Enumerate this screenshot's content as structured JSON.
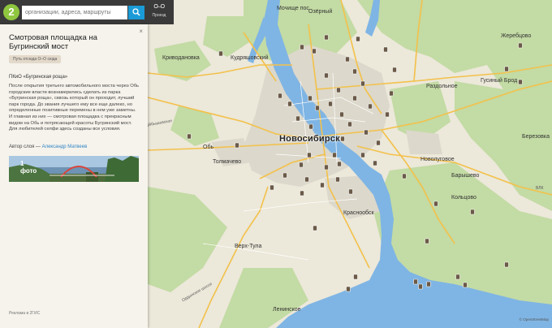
{
  "search": {
    "placeholder": "организации, адреса, маршруты",
    "logo": "2",
    "route_icon": "O–O",
    "route_label": "Проезд"
  },
  "panel": {
    "close": "×",
    "title": "Смотровая площадка на Бугринский мост",
    "route_chip": "Путь отсюда O–O сюда",
    "place_name": "ПКиО «Бугринская роща»",
    "description": "После открытия третьего автомобильного моста через Обь городские власти вознамерились сделать из парка «Бугринская роща», сквозь который он проходит, лучший парк города. До звания лучшего ему все еще далеко, но определенные позитивные перемены в нем уже заметны. И главная из них — смотровая площадка с прекрасным видом на Обь и потрясающей красоты Бугринский мост. Для любителей селфи здесь созданы все условия.",
    "author_prefix": "Автор слоя — ",
    "author_name": "Александр Матвеев",
    "photo_count": "1",
    "photo_label": "фото",
    "ad": "Реклама в 2ГИС"
  },
  "map": {
    "labels": {
      "novosibirsk": "Новосибирск",
      "ob": "Обь",
      "tolmachevo": "Толмачево",
      "krivodanovka": "Криводановка",
      "kudryashovsky": "Кудряшовский",
      "mochishche": "Мочище пос",
      "ozerny": "Озёрный",
      "zherebtsovo": "Жеребцово",
      "razdolnoe": "Раздольное",
      "gusinyi_brod": "Гусиный Брод",
      "berezovka": "Березовка",
      "novolugovoe": "Новолуговое",
      "barysheva": "Барышево",
      "koltsovo": "Кольцово",
      "krasnoobsk": "Краснообск",
      "verkh_tula": "Верх-Тула",
      "leninskoe": "Ленинское",
      "ordynskoe_shosse": "Ордынское шоссе",
      "kuybyshev": "Куйбышевское",
      "vlk": "ВЛК"
    },
    "copyright": "© OpenStreetMap"
  },
  "colors": {
    "forest": "#c3dba4",
    "water": "#7fb5e4",
    "urban": "#dcd8cb",
    "road_major": "#f3c14a",
    "panel_bg": "#f6f3ec",
    "search_btn": "#1a9bd7",
    "link": "#2f83c4"
  },
  "icons": [
    "logo-2gis-icon",
    "search-icon",
    "route-icon",
    "close-icon",
    "poi-marker-icon"
  ]
}
